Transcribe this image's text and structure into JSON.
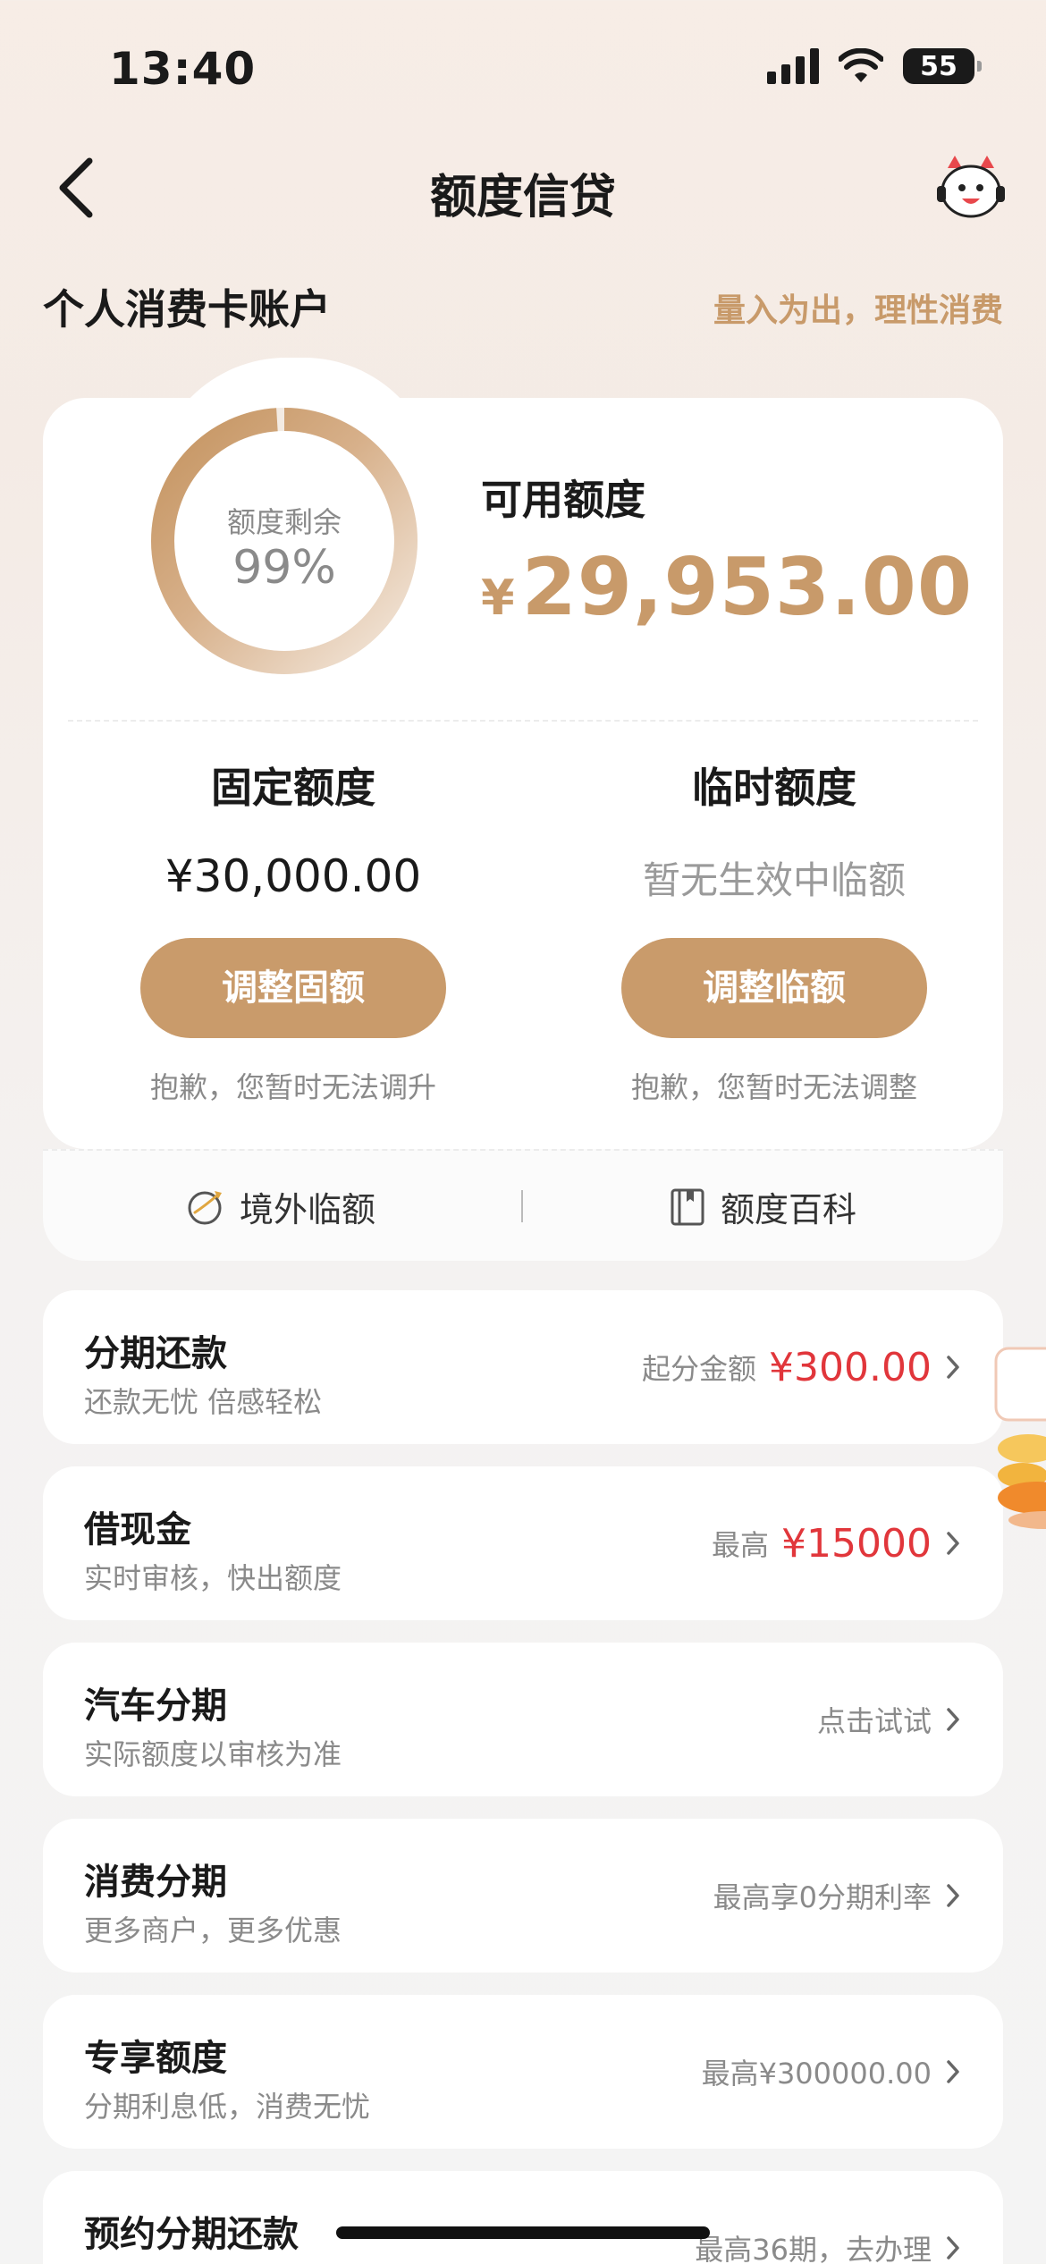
{
  "status": {
    "time": "13:40",
    "battery": "55"
  },
  "nav": {
    "title": "额度信贷"
  },
  "section": {
    "title": "个人消费卡账户",
    "slogan": "量入为出，理性消费"
  },
  "quota": {
    "ring_label": "额度剩余",
    "ring_value": "99%",
    "ring_fraction": 0.99,
    "available_label": "可用额度",
    "currency": "¥",
    "available_amount": "29,953.00",
    "fixed": {
      "title": "固定额度",
      "amount": "¥30,000.00",
      "button": "调整固额",
      "note": "抱歉，您暂时无法调升"
    },
    "temporary": {
      "title": "临时额度",
      "amount": "暂无生效中临额",
      "button": "调整临额",
      "note": "抱歉，您暂时无法调整"
    }
  },
  "shortcuts": [
    {
      "label": "境外临额",
      "icon": "globe-plane-icon"
    },
    {
      "label": "额度百科",
      "icon": "book-icon"
    }
  ],
  "rows": [
    {
      "title": "分期还款",
      "subtitle": "还款无忧 倍感轻松",
      "hint": "起分金额",
      "price": "¥300.00"
    },
    {
      "title": "借现金",
      "subtitle": "实时审核，快出额度",
      "hint": "最高",
      "price": "¥15000"
    },
    {
      "title": "汽车分期",
      "subtitle": "实际额度以审核为准",
      "hint": "点击试试",
      "price": ""
    },
    {
      "title": "消费分期",
      "subtitle": "更多商户，更多优惠",
      "hint": "最高享0分期利率",
      "price": ""
    },
    {
      "title": "专享额度",
      "subtitle": "分期利息低，消费无忧",
      "hint": "最高¥300000.00",
      "price": ""
    },
    {
      "title": "预约分期还款",
      "subtitle": "",
      "hint": "最高36期，去办理",
      "price": ""
    }
  ],
  "colors": {
    "accent": "#c99b6b",
    "price": "#e1363b",
    "gold_text": "#c89a6a"
  }
}
